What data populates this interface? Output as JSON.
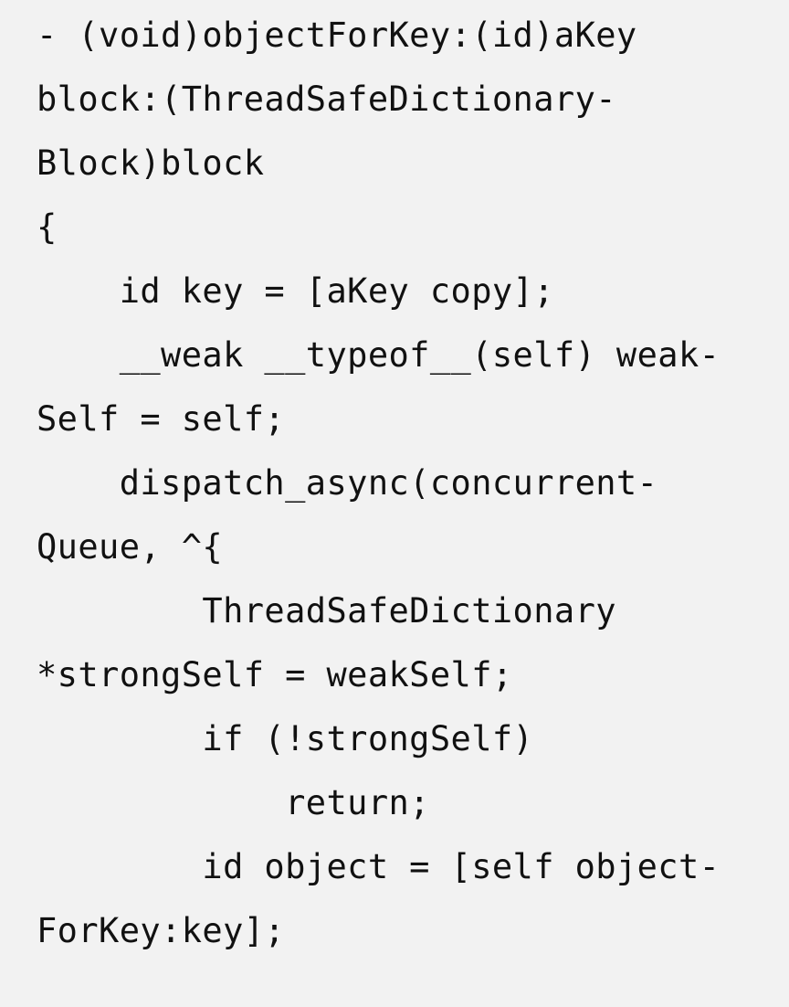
{
  "code": {
    "lines": [
      "- (void)objectForKey:(id)aKey",
      "block:(ThreadSafeDictionary-",
      "Block)block",
      "{",
      "    id key = [aKey copy];",
      "    __weak __typeof__(self) weak-",
      "Self = self;",
      "    dispatch_async(concurrent-",
      "Queue, ^{",
      "        ThreadSafeDictionary",
      "*strongSelf = weakSelf;",
      "        if (!strongSelf)",
      "            return;",
      "        id object = [self object-",
      "ForKey:key];"
    ]
  }
}
